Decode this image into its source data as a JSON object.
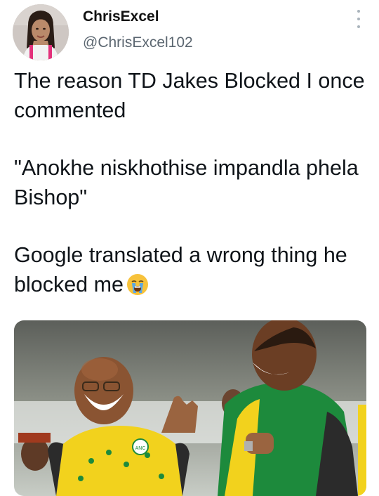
{
  "author": {
    "display_name": "ChrisExcel",
    "handle": "@ChrisExcel102"
  },
  "tweet": {
    "line_1": "The reason TD Jakes Blocked I once commented",
    "line_2": "\"Anokhe niskhothise impandla phela Bishop\"",
    "line_3": "Google translated a wrong thing he blocked me",
    "emoji_icon": "loudly-crying-face-icon"
  },
  "media": {
    "badge_text": "ANC"
  },
  "colors": {
    "text": "#0f1419",
    "secondary_text": "#5b6670",
    "menu_dots": "#aab4bc",
    "shirt_yellow": "#f2d21d",
    "shirt_green": "#1d8a3c"
  }
}
